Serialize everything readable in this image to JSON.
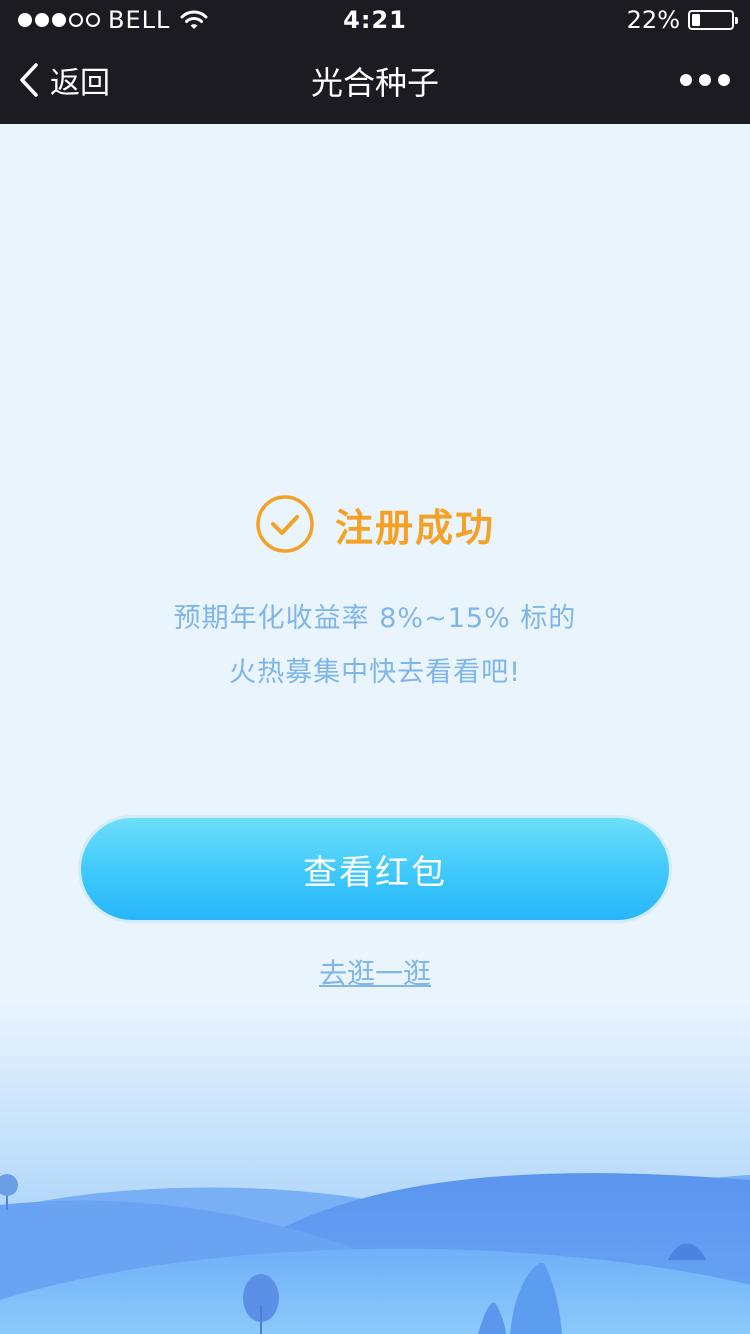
{
  "status_bar": {
    "carrier": "BELL",
    "time": "4:21",
    "battery_percent": "22%",
    "battery_level": 0.22,
    "signal_bars_filled": 3,
    "signal_bars_total": 5
  },
  "nav": {
    "back_label": "返回",
    "title": "光合种子",
    "more_icon": "more-dots-icon"
  },
  "success": {
    "icon": "check-circle-icon",
    "title": "注册成功",
    "line1": "预期年化收益率 8%~15% 标的",
    "line2": "火热募集中快去看看吧!"
  },
  "actions": {
    "primary_label": "查看红包",
    "secondary_label": "去逛一逛"
  },
  "colors": {
    "nav_background": "#1c1b21",
    "accent_orange": "#f5a125",
    "text_blue": "#7fb6e8",
    "button_top": "#6ddff9",
    "button_bottom": "#27b6f9",
    "page_background": "#eaf4fd"
  }
}
